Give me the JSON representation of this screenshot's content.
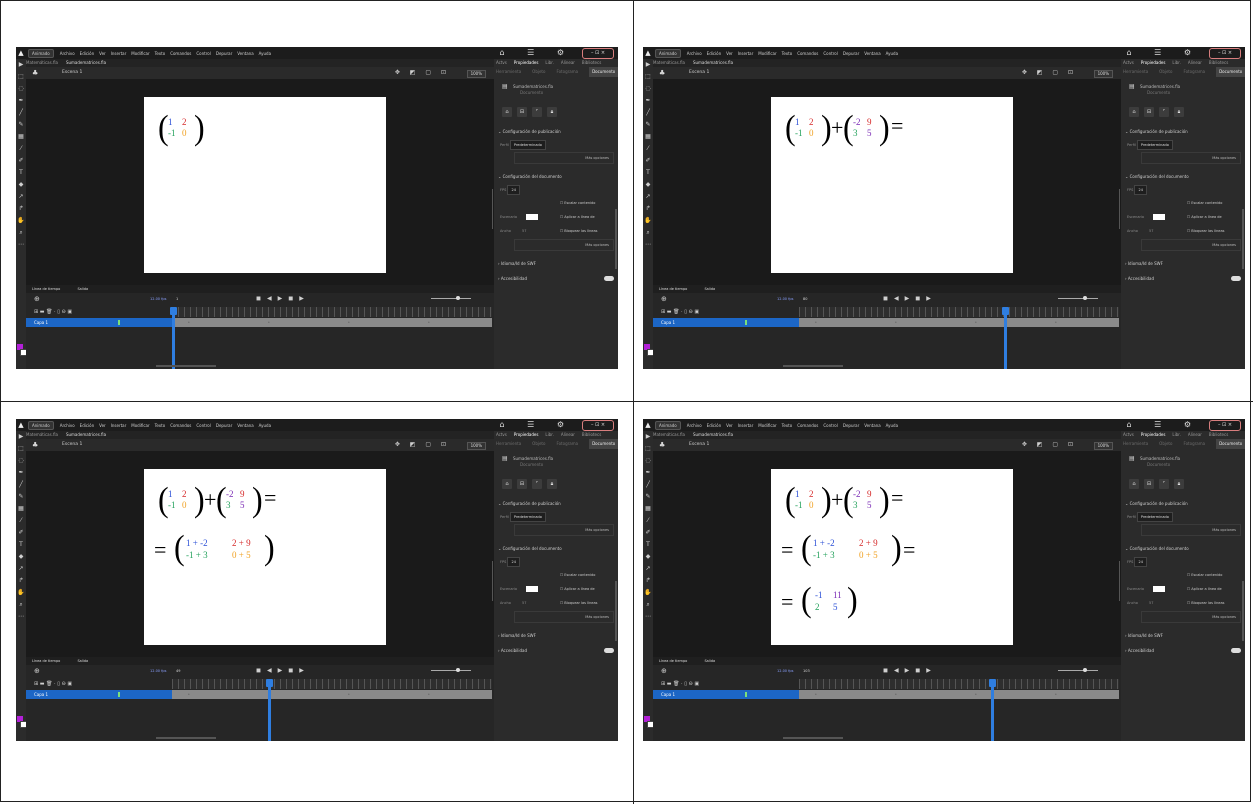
{
  "colors": {
    "blue": "#2a4fd6",
    "red": "#d62a2a",
    "green": "#21a05a",
    "orange": "#f0a020",
    "purple": "#7a2ab5",
    "accent": "#2f7ee0"
  },
  "app": {
    "workspace": "Animado",
    "menu": [
      "Archivo",
      "Edición",
      "Ver",
      "Insertar",
      "Modificar",
      "Texto",
      "Comandos",
      "Control",
      "Depurar",
      "Ventana",
      "Ayuda"
    ],
    "window_controls": "– ⊡ ×",
    "tabs": [
      "Matemáticas.fla",
      "Sumadematrices.fla"
    ],
    "scene": "Escena 1",
    "zoom": "100%",
    "timeline_tabs": [
      "Línea de tiempo",
      "Salida"
    ],
    "layer_name": "Capa 1",
    "props_tabs": [
      "Actvs",
      "Propiedades",
      "Libr.",
      "Alinear",
      "Bibliotecs"
    ],
    "props_subtabs": [
      "Herramienta",
      "Objeto",
      "Fotograma",
      "Documento"
    ],
    "doc_name": "Sumadematrices.fla",
    "doc_type": "Documento",
    "sec_publish": "Configuración de publicación",
    "target_label": "Perfil",
    "target_value": "Predeterminado",
    "more_options": "Más opciones",
    "sec_document": "Configuración del documento",
    "fps_label": "FPS",
    "fps_value": "24",
    "scale_label": "Escalar contenido",
    "stage_label": "Escenario",
    "apply_label": "Aplicar a línea de",
    "size_label": "Ancho",
    "size_value": "57",
    "guides_label": "Bloquear las líneas",
    "accessibility": "Accesibilidad",
    "svg_label": "Idioma/Id de SWF"
  },
  "panels": [
    {
      "fps": "12.00 fps",
      "frame": "1",
      "playhead": 0
    },
    {
      "fps": "12.00 fps",
      "frame": "80",
      "playhead": 0.64
    },
    {
      "fps": "12.00 fps",
      "frame": "49",
      "playhead": 0.3
    },
    {
      "fps": "12.00 fps",
      "frame": "103",
      "playhead": 0.6
    }
  ],
  "math": {
    "A": [
      "1",
      "2",
      "-1",
      "0"
    ],
    "B": [
      "-2",
      "9",
      "3",
      "5"
    ],
    "plus": "+",
    "eq": "=",
    "S": [
      "1 + -2",
      "2 + 9",
      "-1 + 3",
      "0 + 5"
    ],
    "R": [
      "-1",
      "11",
      "2",
      "5"
    ]
  }
}
